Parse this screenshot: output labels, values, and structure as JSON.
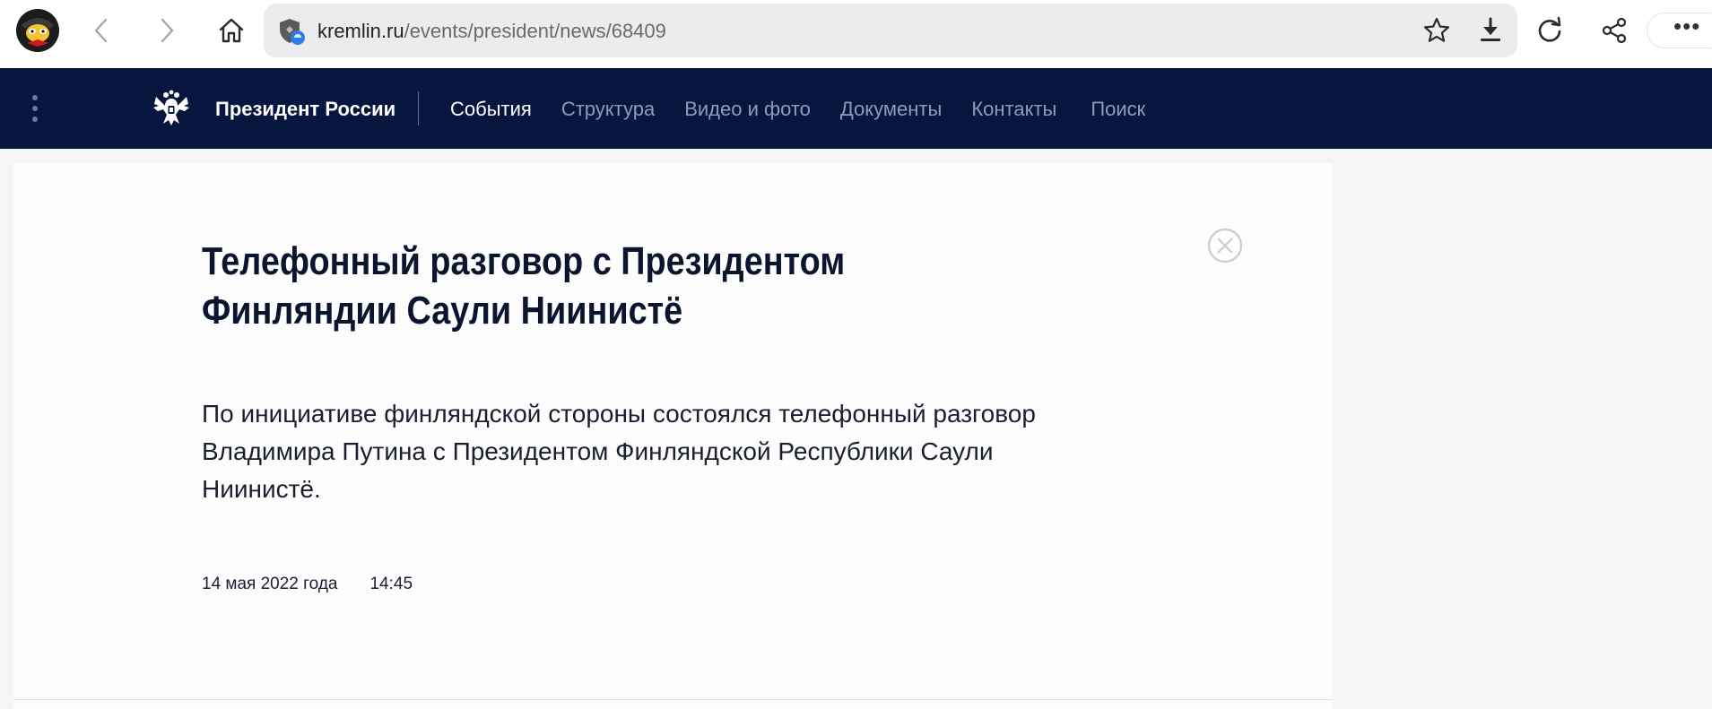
{
  "browser": {
    "url_host": "kremlin.ru",
    "url_path": "/events/president/news/68409",
    "more_label": "•••"
  },
  "site": {
    "title": "Президент России",
    "nav": [
      {
        "label": "События",
        "active": true
      },
      {
        "label": "Структура",
        "active": false
      },
      {
        "label": "Видео и фото",
        "active": false
      },
      {
        "label": "Документы",
        "active": false
      },
      {
        "label": "Контакты",
        "active": false
      },
      {
        "label": "Поиск",
        "active": false
      }
    ]
  },
  "article": {
    "headline": "Телефонный разговор с Президентом Финляндии Саули Ниинистё",
    "lead": "По инициативе финляндской стороны состоялся телефонный разговор Владимира Путина с Президентом Финляндской Республики Саули Ниинистё.",
    "date": "14 мая 2022 года",
    "time": "14:45"
  },
  "colors": {
    "navbar_bg": "#06163f",
    "nav_inactive": "#8f9bb8",
    "nav_active": "#ffffff",
    "headline": "#0c1530"
  }
}
